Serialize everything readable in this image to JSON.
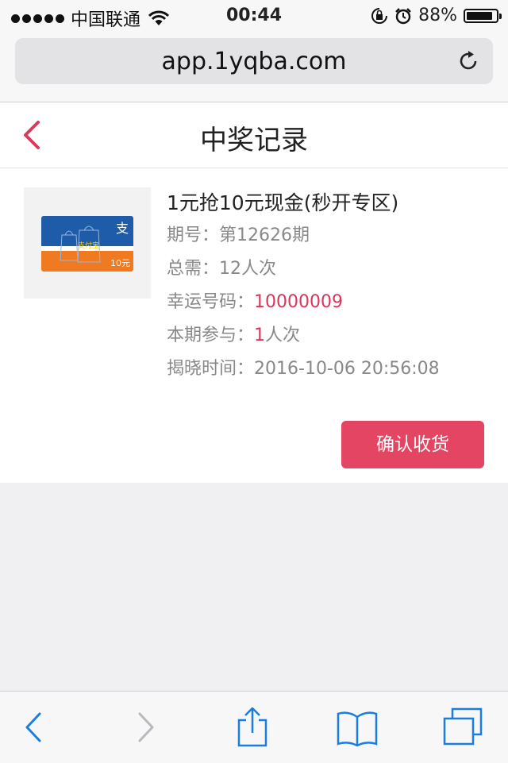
{
  "status_bar": {
    "carrier": "中国联通",
    "time": "00:44",
    "battery_pct": "88%",
    "battery_level": 0.88
  },
  "browser": {
    "url": "app.1yqba.com"
  },
  "header": {
    "title": "中奖记录"
  },
  "record": {
    "product_title": "1元抢10元现金(秒开专区)",
    "card_value": "10元",
    "rows": {
      "period_label": "期号：",
      "period_value": "第12626期",
      "total_label": "总需：",
      "total_value": "12人次",
      "lucky_label": "幸运号码：",
      "lucky_value": "10000009",
      "join_label": "本期参与：",
      "join_count": "1",
      "join_unit": "人次",
      "reveal_label": "揭晓时间：",
      "reveal_value": "2016-10-06 20:56:08"
    },
    "confirm_label": "确认收货"
  },
  "colors": {
    "accent": "#e44563",
    "highlight": "#d9365a",
    "toolbar_blue": "#1a7de0"
  },
  "icons": [
    "signal-dots-icon",
    "wifi-icon",
    "lock-rotation-icon",
    "alarm-icon",
    "battery-icon",
    "reload-icon",
    "back-chevron-icon",
    "toolbar-back-icon",
    "toolbar-forward-icon",
    "share-icon",
    "bookmarks-icon",
    "tabs-icon"
  ]
}
